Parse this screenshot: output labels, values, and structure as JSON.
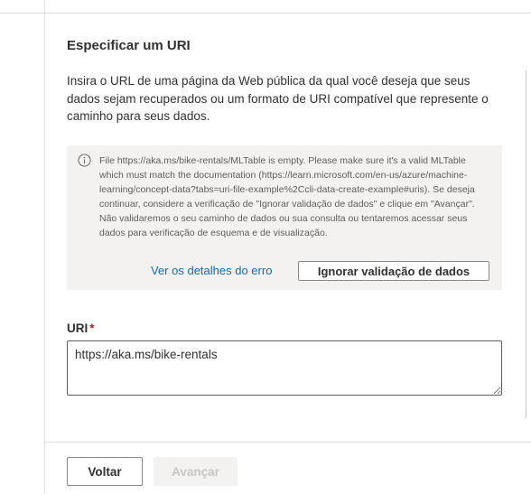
{
  "section": {
    "title": "Especificar um URI",
    "description": "Insira o URL de uma página da Web pública da qual você deseja que seus dados sejam recuperados ou um formato de URI compatível que represente o caminho para seus dados."
  },
  "message_bar": {
    "icon": "info-icon",
    "text": "File https://aka.ms/bike-rentals/MLTable is empty. Please make sure it's a valid MLTable which must match the documentation (https://learn.microsoft.com/en-us/azure/machine-learning/concept-data?tabs=uri-file-example%2Ccli-data-create-example#uris). Se deseja continuar, considere a verificação de \"Ignorar validação de dados\" e clique em \"Avançar\". Não validaremos o seu caminho de dados ou sua consulta ou tentaremos acessar seus dados para verificação de esquema e de visualização.",
    "error_link": "Ver os detalhes do erro",
    "ignore_button": "Ignorar validação de dados"
  },
  "uri_field": {
    "label": "URI",
    "required_marker": "*",
    "value": "https://aka.ms/bike-rentals"
  },
  "footer": {
    "back_label": "Voltar",
    "next_label": "Avançar"
  },
  "colors": {
    "link": "#0f6cbd",
    "required": "#a4262c",
    "message_background": "#f3f2f1",
    "disabled_text": "#c8c6c4"
  }
}
